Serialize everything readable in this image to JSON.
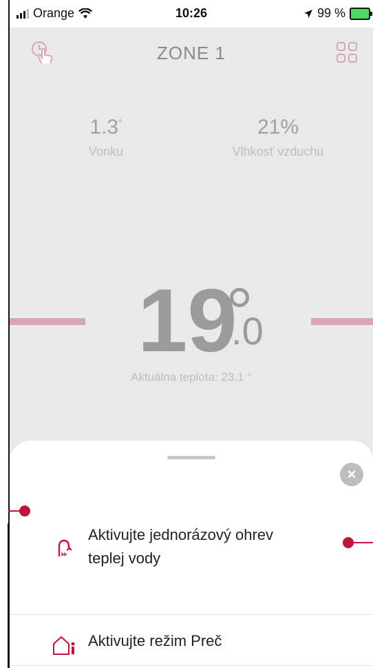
{
  "status_bar": {
    "carrier": "Orange",
    "time": "10:26",
    "battery_text": "99 %"
  },
  "header": {
    "title": "ZONE 1"
  },
  "weather": {
    "outside_value": "1.3",
    "outside_unit": "°",
    "outside_label": "Vonku",
    "humidity_value": "21%",
    "humidity_label": "Vlhkosť vzduchu"
  },
  "thermostat": {
    "setpoint_int": "19",
    "setpoint_dec": "0",
    "current_label": "Aktuálna teplota: 23.1 °"
  },
  "sheet": {
    "close_symbol": "×",
    "actions": [
      {
        "label_line1": "Aktivujte jednorázový ohrev",
        "label_line2": "teplej vody"
      },
      {
        "label_line1": "Aktivujte režim Preč"
      }
    ]
  },
  "colors": {
    "accent": "#c0143c",
    "setpoint_bar": "#d9a5b3",
    "background": "#e9e9e9"
  }
}
